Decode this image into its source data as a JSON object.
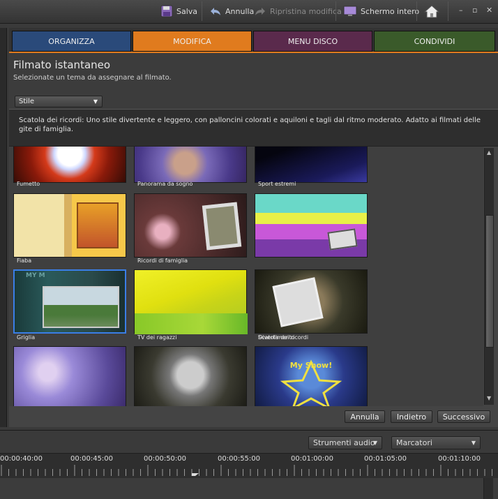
{
  "toolbar": {
    "save_label": "Salva",
    "undo_label": "Annulla",
    "redo_label": "Ripristina modifica",
    "fullscreen_label": "Schermo intero"
  },
  "tabs": [
    {
      "label": "ORGANIZZA",
      "color": "#2a4a7a"
    },
    {
      "label": "MODIFICA",
      "color": "#e07b1e"
    },
    {
      "label": "MENU DISCO",
      "color": "#5a2a4c"
    },
    {
      "label": "CONDIVIDI",
      "color": "#3a5a2a"
    }
  ],
  "panel": {
    "title": "Filmato istantaneo",
    "subtitle": "Selezionate un tema da assegnare al filmato.",
    "style_select": "Stile",
    "description": "Scatola dei ricordi: Uno stile divertente e leggero, con palloncini colorati e aquiloni e tagli dal ritmo moderato. Adatto ai filmati delle gite di famiglia."
  },
  "themes": [
    {
      "label": "Fumetto"
    },
    {
      "label": "Panorama da sogno"
    },
    {
      "label": "Sport estremi"
    },
    {
      "label": "Fiaba"
    },
    {
      "label": "Ricordi di famiglia"
    },
    {
      "label": "Divertimento"
    },
    {
      "label": "Griglia",
      "selected": true
    },
    {
      "label": "TV dei ragazzi"
    },
    {
      "label": "Scatola dei ricordi"
    },
    {
      "label": ""
    },
    {
      "label": ""
    },
    {
      "label": "My Show!"
    }
  ],
  "buttons": {
    "cancel": "Annulla",
    "back": "Indietro",
    "next": "Successivo"
  },
  "timeline": {
    "audio_tools": "Strumenti audio",
    "markers": "Marcatori",
    "timecodes": [
      "00:00:40:00",
      "00:00:45:00",
      "00:00:50:00",
      "00:00:55:00",
      "00:01:00:00",
      "00:01:05:00",
      "00:01:10:00"
    ]
  },
  "colors": {
    "accent": "#e07b1e",
    "selection": "#3a7ee6",
    "track_green": "#3ac24a"
  }
}
